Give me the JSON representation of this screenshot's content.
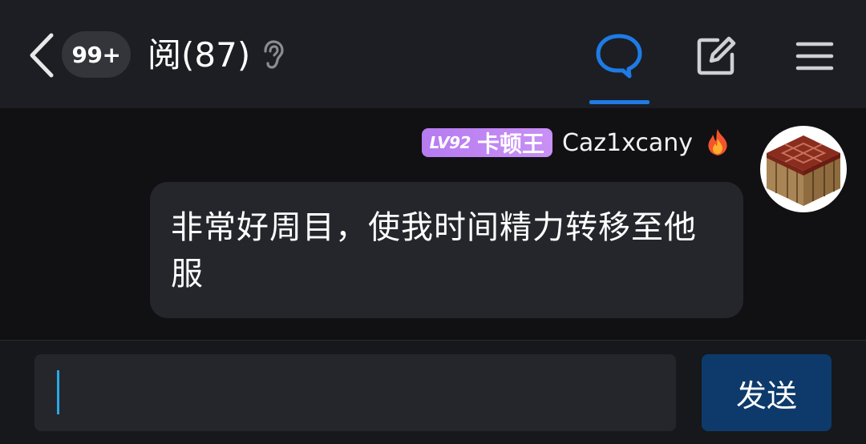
{
  "header": {
    "unread_count": "99+",
    "title": "阅(87)",
    "icons": {
      "back": "chevron-left-icon",
      "listen": "ear-icon",
      "chat": "chat-bubble-icon",
      "edit": "edit-icon",
      "menu": "menu-icon"
    }
  },
  "message": {
    "level": "LV92",
    "level_title": "卡顿王",
    "sender": "Caz1xcany",
    "sender_badge_icon": "fire-icon",
    "avatar_icon": "crafting-table-avatar",
    "text": "非常好周目，使我时间精力转移至他服"
  },
  "composer": {
    "input_value": "",
    "send_label": "发送"
  },
  "colors": {
    "accent": "#1e7be6",
    "header_bg": "#1c1e23",
    "bubble_bg": "#24262b",
    "level_badge": "#c08af2",
    "send_button": "#0d3a6b",
    "caret": "#2aa8e8"
  }
}
